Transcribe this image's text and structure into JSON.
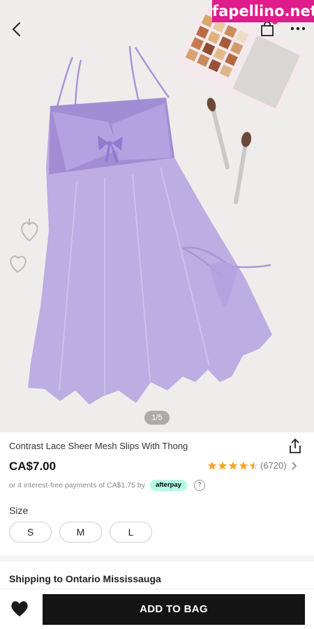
{
  "watermark": "fapellino.net",
  "gallery": {
    "pager": "1/5"
  },
  "product": {
    "title": "Contrast Lace Sheer Mesh Slips With Thong",
    "price": "CA$7.00",
    "rating_count": "(6720)",
    "rating_stars": 4.5,
    "afterpay_text": "or 4 interest-free payments of CA$1.75 by",
    "afterpay_brand": "afterpay",
    "help_glyph": "?"
  },
  "sizes": {
    "label": "Size",
    "options": [
      "S",
      "M",
      "L"
    ]
  },
  "shipping": {
    "label": "Shipping to Ontario Mississauga"
  },
  "actions": {
    "add_to_bag": "ADD TO BAG"
  },
  "colors": {
    "accent_dark": "#141414",
    "star": "#f5a623",
    "afterpay": "#b2fce4",
    "watermark": "#e01b8a",
    "garment": "#b3a1e0"
  },
  "icons": [
    "back-icon",
    "bag-icon",
    "more-icon",
    "share-icon",
    "star-icon",
    "chevron-right-icon",
    "heart-icon",
    "help-icon"
  ]
}
